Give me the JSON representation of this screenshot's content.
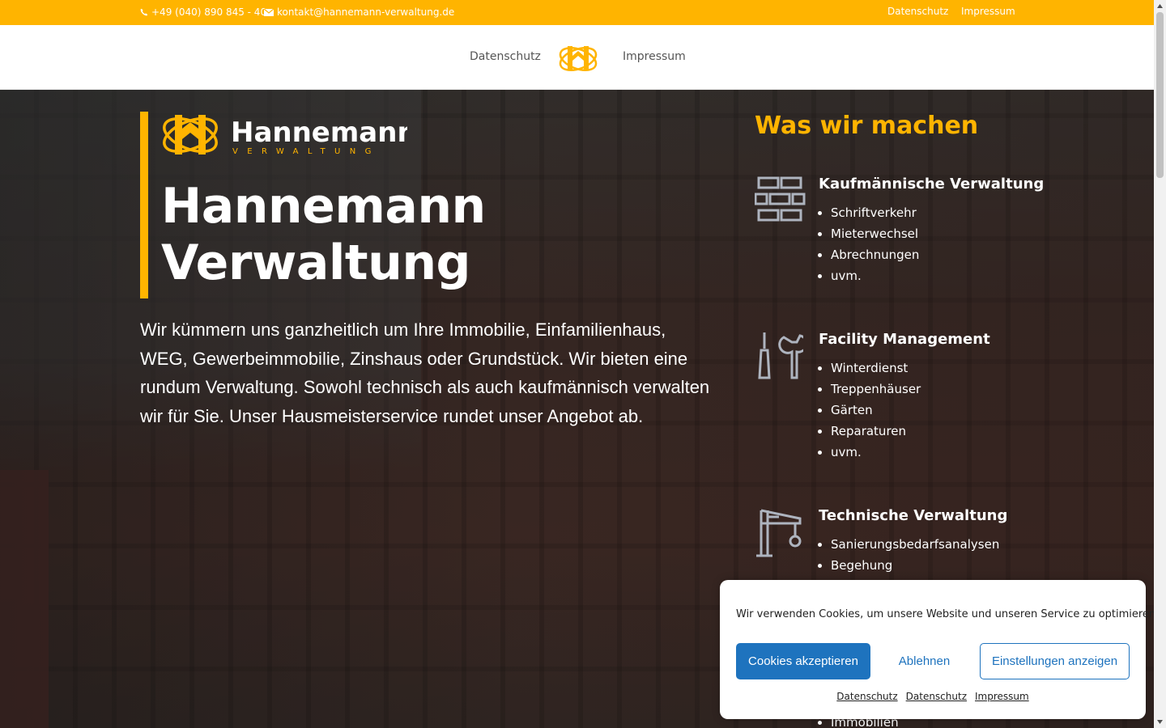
{
  "topbar": {
    "phone": "+49 (040) 890 845 - 40",
    "email": "kontakt@hannemann-verwaltung.de",
    "links": [
      "Datenschutz",
      "Impressum"
    ]
  },
  "nav": {
    "left_link": "Datenschutz",
    "right_link": "Impressum"
  },
  "hero": {
    "logo_name": "Hannemann",
    "logo_sub": "VERWALTUNG",
    "title_line1": "Hannemann",
    "title_line2": "Verwaltung",
    "text": "Wir kümmern uns ganzheitlich um Ihre Immobilie, Einfamilienhaus, WEG, Gewerbeimmobilie, Zinshaus oder Grundstück. Wir bieten eine rundum Verwaltung. Sowohl technisch als auch kaufmännisch verwalten wir für Sie. Unser Hausmeisterservice rundet unser Angebot ab."
  },
  "services": {
    "heading": "Was wir machen",
    "items": [
      {
        "title": "Kaufmännische Verwaltung",
        "icon": "bricks-icon",
        "bullets": [
          "Schriftverkehr",
          "Mieterwechsel",
          "Abrechnungen",
          "uvm."
        ]
      },
      {
        "title": "Facility Management",
        "icon": "tools-icon",
        "bullets": [
          "Winterdienst",
          "Treppenhäuser",
          "Gärten",
          "Reparaturen",
          "uvm."
        ]
      },
      {
        "title": "Technische Verwaltung",
        "icon": "crane-icon",
        "bullets": [
          "Sanierungsbedarfsanalysen",
          "Begehung"
        ]
      }
    ],
    "partial_bullet": "Immobilien"
  },
  "cookie": {
    "text": "Wir verwenden Cookies, um unsere Website und unseren Service zu optimieren.",
    "accept": "Cookies akzeptieren",
    "deny": "Ablehnen",
    "settings": "Einstellungen anzeigen",
    "links": [
      "Datenschutz",
      "Datenschutz",
      "Impressum"
    ]
  },
  "colors": {
    "accent": "#ffb400",
    "button_blue": "#1e73be"
  }
}
